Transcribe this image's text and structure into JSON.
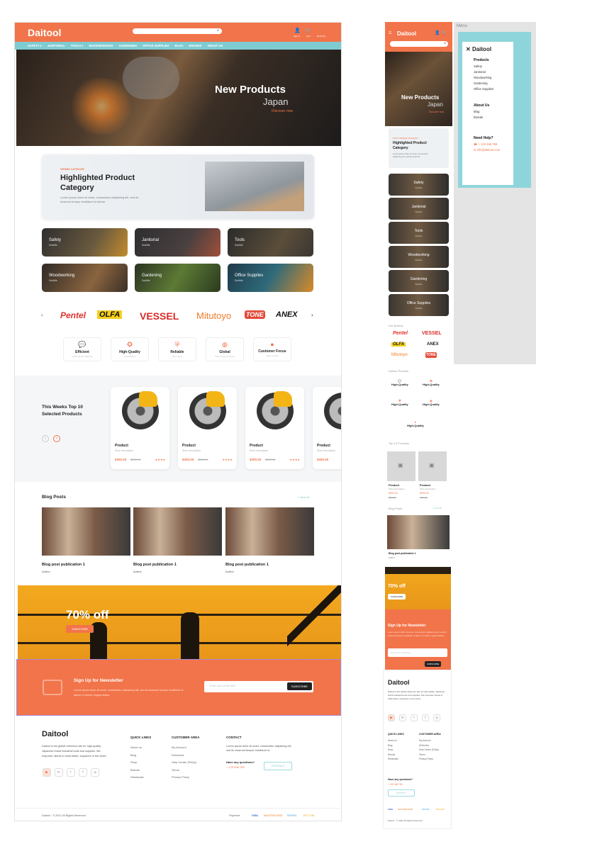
{
  "header": {
    "logo": "Daitool",
    "signin": "Sign In",
    "cart": "Cart",
    "cart_total": "$0.00 (0)"
  },
  "nav": [
    "SAFETY ▾",
    "JANITORIAL",
    "TOOLS ▾",
    "WOODWORKING",
    "GARDENING",
    "OFFICE SUPPLIES",
    "BLOG",
    "BRANDS",
    "ABOUT US"
  ],
  "hero": {
    "title": "New Products",
    "subtitle": "Japan",
    "link": "Discover now"
  },
  "highlight": {
    "eyebrow": "VIEWED CATEGORY",
    "title": "Highlighted Product Category",
    "text": "Lorem ipsum dolor sit amet, consectetur adipiscing elit, sed do eiusmod tempor incididunt ut labore"
  },
  "categories": [
    {
      "name": "Safety",
      "sub": "Subtitle"
    },
    {
      "name": "Janitorial",
      "sub": "Subtitle"
    },
    {
      "name": "Tools",
      "sub": "Subtitle"
    },
    {
      "name": "Woodworking",
      "sub": "Subtitle"
    },
    {
      "name": "Gardening",
      "sub": "Subtitle"
    },
    {
      "name": "Office Supplies",
      "sub": "Subtitle"
    }
  ],
  "brands": [
    {
      "name": "Pentel",
      "color": "#e0332d"
    },
    {
      "name": "OLFA",
      "color": "#111111"
    },
    {
      "name": "VESSEL",
      "color": "#d92a2a"
    },
    {
      "name": "Mitutoyo",
      "color": "#f07a2a"
    },
    {
      "name": "TONE",
      "color": "#e34a3a"
    },
    {
      "name": "ANEX",
      "color": "#111111"
    }
  ],
  "features": [
    {
      "label": "Efficient",
      "sub": "International Shipping"
    },
    {
      "label": "High-Quality",
      "sub": "Guaranteed"
    },
    {
      "label": "Reliable",
      "sub": "Since Ever"
    },
    {
      "label": "Global",
      "sub": "Ships to 60 countries"
    },
    {
      "label": "Customer Focus",
      "sub": "Here to Help"
    }
  ],
  "top10": {
    "title": "This Weeks Top 10 Selected Products",
    "name": "Product",
    "desc": "Short description",
    "price": "$300.00",
    "old": "$350.00",
    "stars": "★★★★"
  },
  "blog": {
    "title": "Blog Posts",
    "view_all": "+ View All",
    "post": "Blog post publication 1",
    "author": "Author"
  },
  "promo": {
    "title": "70% off",
    "cta": "SUBSCRIBE"
  },
  "newsletter": {
    "title": "Sign Up for Newsletter",
    "text": "Lorem ipsum dolor sit amet, consectetur adipiscing elit, sed do eiusmod tempor incididunt ut labore et dolore magna aliqua.",
    "placeholder": "Enter your email here",
    "cta": "SUBSCRIBE"
  },
  "footer": {
    "logo": "Daitool",
    "about": "Daitool is the global reference site for high-quality, Japanese brand industrial tools and supplies. We empower clients to build better, anywhere in the world.",
    "quick_title": "QUICK LINKS",
    "quick": [
      "About us",
      "Blog",
      "Shop",
      "Brands",
      "Wholesale"
    ],
    "customer_title": "CUSTOMER AREA",
    "customer": [
      "My Account",
      "Deliveries",
      "Help Center (FAQs)",
      "Terms",
      "Privacy Policy"
    ],
    "contact_title": "CONTACT",
    "contact_text": "Lorem ipsum dolor sit amet, consectetur adipiscing elit, sed do eiusmod tempor incididunt ut",
    "questions": "Have any questions?",
    "phone": "+ 123 456 789",
    "contact_btn": "CONTACT",
    "copyright": "Daitool  ·  © 2021 All Rights Reserved",
    "payment_label": "Payment",
    "payments": [
      "VISA",
      "MASTERCARD",
      "PAYPAL",
      "BITCOIN"
    ]
  },
  "mobile": {
    "menu_label": "Menu",
    "hero_title": "New Products",
    "hero_sub": "Japan",
    "hero_link": "Discover now",
    "hl_eyebrow": "MOST VIEWED CATEGORY",
    "hl_title": "Highlighted Product Category",
    "hl_text": "Lorem ipsum dolor sit amet, consectetur adipiscing elit, sed do eiusmod",
    "menu": {
      "logo": "Daitool",
      "products": "Products",
      "items": [
        "Safety",
        "Janitorial",
        "Woodworking",
        "Gardening",
        "Office Supplies"
      ],
      "about": "About Us",
      "about_items": [
        "Blog",
        "Brands"
      ],
      "help": "Need Help?",
      "phone": "+ 123 456 789",
      "email": "info@daitool.com"
    },
    "our_brands": "Our Brands",
    "deliver": "Deliver Promise",
    "features": [
      "High-Quality",
      "High-Quality",
      "High-Quality",
      "High-Quality",
      "High-Quality"
    ],
    "top10": "Top 10 Products",
    "product": "Product",
    "desc": "Short description",
    "price": "$300.00",
    "old": "$350.00",
    "blog": "Blog Posts",
    "view_all": "+ View All",
    "post": "Blog post publication 1",
    "author": "Author",
    "promo": "70% off",
    "promo_cta": "SUBSCRIBE",
    "news_title": "Sign Up for Newsletter",
    "news_text": "Lorem ipsum dolor sit amet, consectetur adipiscing elit, sed do eiusmod tempor incididunt ut labore et dolore magna aliqua.",
    "news_placeholder": "Enter your email here",
    "news_cta": "SUBSCRIBE",
    "copyright": "Daitool  ·  © 2021 All Rights Reserved"
  }
}
